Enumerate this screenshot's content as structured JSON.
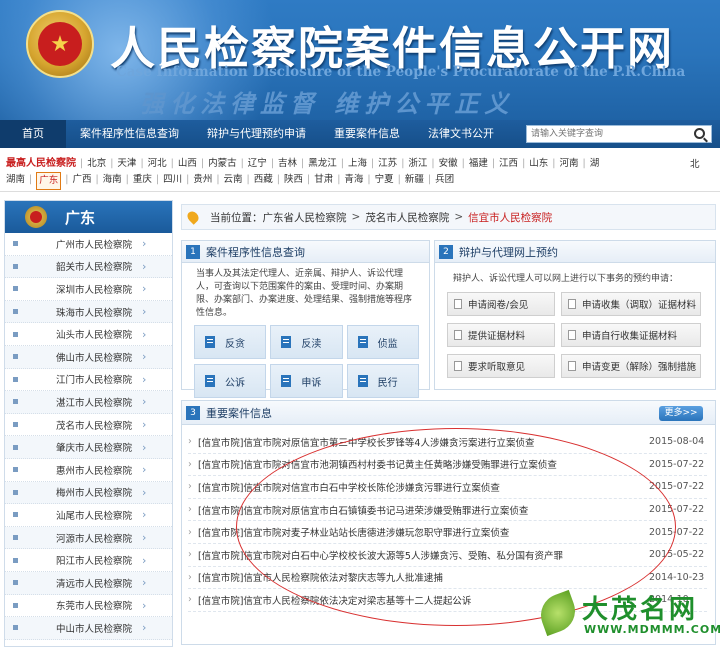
{
  "header": {
    "title": "人民检察院案件信息公开网",
    "subtitle": "Case Information Disclosure of the People's Procuratorate of the P.R.China",
    "slogan": "强化法律监督 维护公平正义"
  },
  "nav": {
    "items": [
      "首页",
      "案件程序性信息查询",
      "辩护与代理预约申请",
      "重要案件信息",
      "法律文书公开"
    ],
    "search_placeholder": "请输入关键字查询"
  },
  "provinces": {
    "first": "最高人民检察院",
    "row1": [
      "北京",
      "天津",
      "河北",
      "山西",
      "内蒙古",
      "辽宁",
      "吉林",
      "黑龙江",
      "上海",
      "江苏",
      "浙江",
      "安徽",
      "福建",
      "江西",
      "山东",
      "河南",
      "湖"
    ],
    "row2": [
      "湖南",
      "广东",
      "广西",
      "海南",
      "重庆",
      "四川",
      "贵州",
      "云南",
      "西藏",
      "陕西",
      "甘肃",
      "青海",
      "宁夏",
      "新疆",
      "兵团"
    ],
    "overflow": "北"
  },
  "sidebar": {
    "title": "广东",
    "items": [
      "广州市人民检察院",
      "韶关市人民检察院",
      "深圳市人民检察院",
      "珠海市人民检察院",
      "汕头市人民检察院",
      "佛山市人民检察院",
      "江门市人民检察院",
      "湛江市人民检察院",
      "茂名市人民检察院",
      "肇庆市人民检察院",
      "惠州市人民检察院",
      "梅州市人民检察院",
      "汕尾市人民检察院",
      "河源市人民检察院",
      "阳江市人民检察院",
      "清远市人民检察院",
      "东莞市人民检察院",
      "中山市人民检察院"
    ]
  },
  "breadcrumb": {
    "label": "当前位置：",
    "items": [
      "广东省人民检察院",
      "茂名市人民检察院"
    ],
    "current": "信宜市人民检察院"
  },
  "panel1": {
    "num": "1",
    "title": "案件程序性信息查询",
    "desc": "当事人及其法定代理人、近亲属、辩护人、诉讼代理人，可查询以下范围案件的案由、受理时间、办案期限、办案部门、办案进度、处理结果、强制措施等程序性信息。",
    "buttons": [
      "反贪",
      "反渎",
      "侦监",
      "公诉",
      "申诉",
      "民行"
    ]
  },
  "panel2": {
    "num": "2",
    "title": "辩护与代理网上预约",
    "desc": "辩护人、诉讼代理人可以网上进行以下事务的预约申请：",
    "buttons": [
      "申请阅卷/会见",
      "申请收集（调取）证据材料",
      "提供证据材料",
      "申请自行收集证据材料",
      "要求听取意见",
      "申请变更（解除）强制措施"
    ]
  },
  "panel3": {
    "num": "3",
    "title": "重要案件信息",
    "more": "更多>>",
    "cases": [
      {
        "title": "[信宜市院]信宜市院对原信宜市第三中学校长罗锋等4人涉嫌贪污案进行立案侦查",
        "date": "2015-08-04"
      },
      {
        "title": "[信宜市院]信宜市院对信宜市池洞镇西村村委书记黄主任黄略涉嫌受贿罪进行立案侦查",
        "date": "2015-07-22"
      },
      {
        "title": "[信宜市院]信宜市院对信宜市白石中学校长陈伦涉嫌贪污罪进行立案侦查",
        "date": "2015-07-22"
      },
      {
        "title": "[信宜市院]信宜市院对原信宜市白石镇镇委书记马进荣涉嫌受贿罪进行立案侦查",
        "date": "2015-07-22"
      },
      {
        "title": "[信宜市院]信宜市院对麦子林业站站长唐德进涉嫌玩忽职守罪进行立案侦查",
        "date": "2015-07-22"
      },
      {
        "title": "[信宜市院]信宜市院对白石中心学校校长波大源等5人涉嫌贪污、受贿、私分国有资产罪",
        "date": "2015-05-22"
      },
      {
        "title": "[信宜市院]信宜市人民检察院依法对黎庆志等九人批准逮捕",
        "date": "2014-10-23"
      },
      {
        "title": "[信宜市院]信宜市人民检察院依法决定对梁志基等十二人提起公诉",
        "date": "2014-10-"
      }
    ]
  },
  "watermark": {
    "name": "大茂名网",
    "url": "WWW.MDMMM.COM"
  },
  "colors": {
    "brand_blue": "#2a74bb",
    "nav_dark": "#164f89",
    "accent_red": "#c81e1e",
    "ring_red": "#d83030",
    "watermark_green": "#1f8f2c"
  }
}
